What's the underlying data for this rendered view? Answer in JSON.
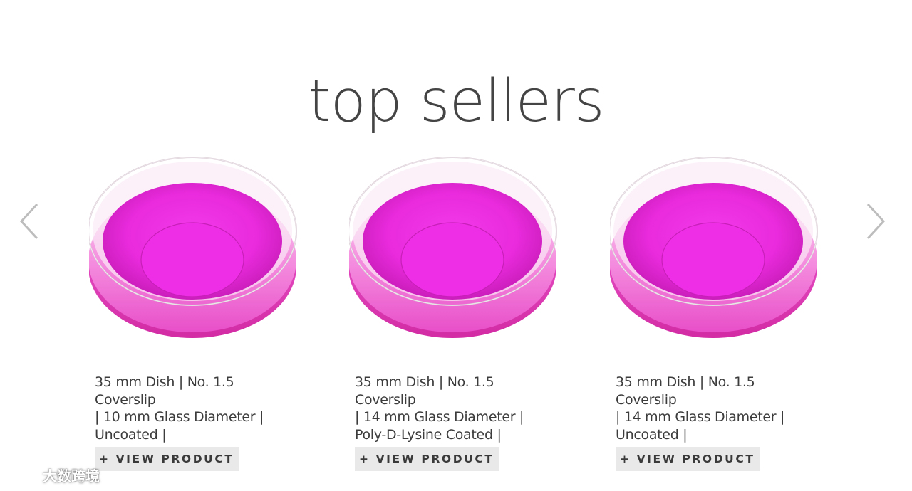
{
  "heading": "top sellers",
  "colors": {
    "accent": "#e020c8",
    "liquid_light": "#ff46ea",
    "liquid_dark": "#b0158d",
    "button_bg": "#e9e9e9",
    "arrow": "#bdbdbd"
  },
  "carousel": {
    "prev_icon": "chevron-left-icon",
    "next_icon": "chevron-right-icon"
  },
  "products": [
    {
      "line1": "35 mm Dish | No. 1.5 Coverslip",
      "line2": "| 10 mm Glass Diameter |",
      "line3": "Uncoated |",
      "button_label": "+ VIEW PRODUCT"
    },
    {
      "line1": "35 mm Dish | No. 1.5 Coverslip",
      "line2": "| 14 mm Glass Diameter |",
      "line3": "Poly-D-Lysine Coated |",
      "button_label": "+ VIEW PRODUCT"
    },
    {
      "line1": "35 mm Dish | No. 1.5 Coverslip",
      "line2": "| 14 mm Glass Diameter |",
      "line3": "Uncoated |",
      "button_label": "+ VIEW PRODUCT"
    }
  ],
  "watermark": {
    "text": "大数跨境"
  }
}
